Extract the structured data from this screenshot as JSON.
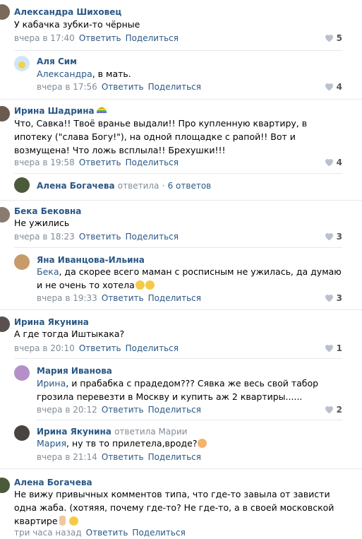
{
  "actions": {
    "reply": "Ответить",
    "share": "Поделиться"
  },
  "c1": {
    "name": "Александра Шиховец",
    "text": "У кабачка зубки-то чёрные",
    "time": "вчера в 17:40",
    "likes": "5"
  },
  "c2": {
    "name": "Аля Сим",
    "mention": "Александра",
    "text": ", в мать.",
    "time": "вчера в 17:56",
    "likes": "4"
  },
  "c3": {
    "name": "Ирина Шадрина",
    "text": "Что, Савка!! Твоё вранье выдали!! Про купленную квартиру, в ипотеку (\"слава Богу!\"), на одной площадке с рапой!! Вот и возмущена! Что ложь всплыла!! Брехушки!!!",
    "time": "вчера в 19:58",
    "likes": "4"
  },
  "thread3": {
    "name": "Алена Богачева",
    "action": "ответила",
    "dot": "·",
    "count": "6 ответов"
  },
  "c4": {
    "name": "Бека Бековна",
    "text": "Не ужились",
    "time": "вчера в 18:23",
    "likes": "3"
  },
  "c5": {
    "name": "Яна Иванцова-Ильина",
    "mention": "Бека",
    "text": ", да скорее всего маман с росписным не ужилась, да думаю и не очень то хотела",
    "time": "вчера в 19:33",
    "likes": "3"
  },
  "c6": {
    "name": "Ирина Якунина",
    "text": "А где тогда Иштыкака?",
    "time": "вчера в 20:10",
    "likes": "1"
  },
  "c7": {
    "name": "Мария Иванова",
    "mention": "Ирина",
    "text": ", и прабабка с прадедом??? Сявка же весь свой табор грозила перевезти в Москву и купить аж 2 квартиры......",
    "time": "вчера в 20:12",
    "likes": "2"
  },
  "c8": {
    "name": "Ирина Якунина",
    "action": "ответила Марии",
    "mention": "Мария",
    "text": ", ну тв то прилетела,вроде?",
    "time": "вчера в 21:14"
  },
  "c9": {
    "name": "Алена Богачева",
    "text": "Не вижу привычных комментов типа, что где-то завыла от зависти одна жаба. (хотяяя, почему где-то? Не где-то, а в своей московской квартире",
    "time": "три часа назад"
  },
  "colors": {
    "link": "#2a5885",
    "meta": "#818c99",
    "separator": "#e7e8ec"
  }
}
